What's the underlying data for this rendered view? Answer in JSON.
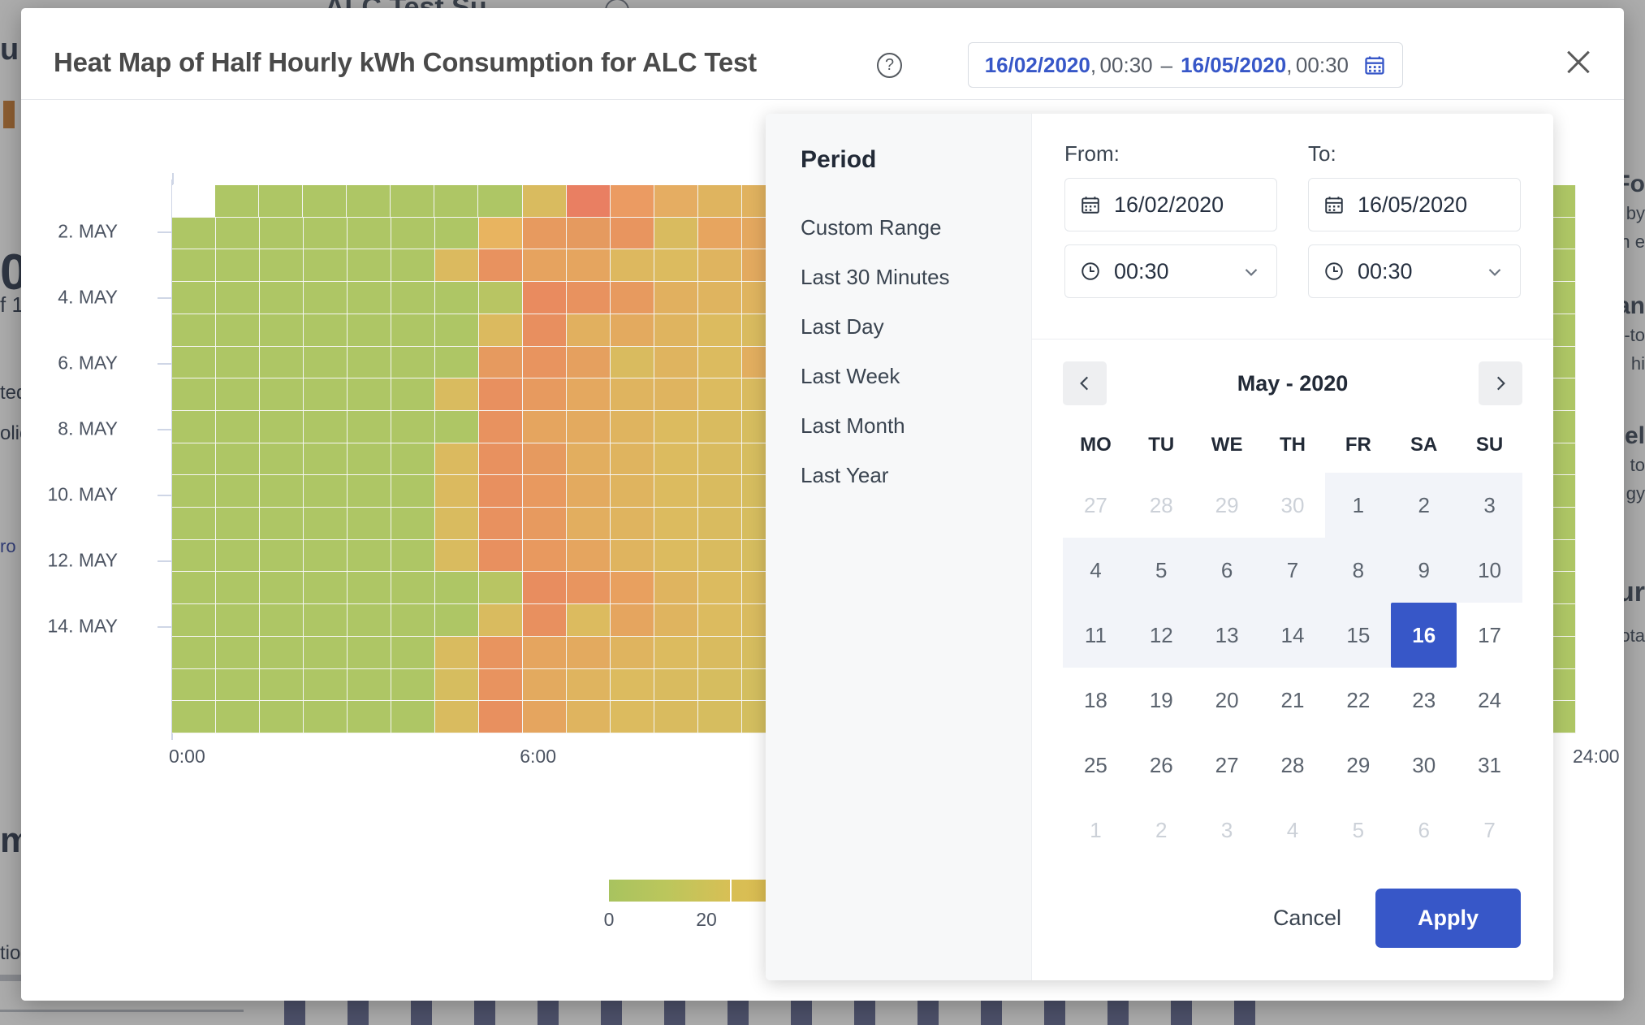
{
  "background": {
    "top_heading": "ALC Test Su",
    "left_fragments": [
      "u:",
      "0",
      "f 1",
      "ted",
      "olic",
      "ro",
      "m",
      "tio"
    ],
    "right_fragments": [
      "Fo",
      "by",
      "n e",
      "an",
      "-to",
      "hi",
      "el",
      "to",
      "gy",
      "ur",
      "ota"
    ]
  },
  "modal": {
    "title": "Heat Map of Half Hourly kWh Consumption for ALC Test",
    "help_icon": "question-mark-circle-icon",
    "close_icon": "close-icon",
    "range_button": {
      "from_date": "16/02/2020",
      "from_time": "00:30",
      "separator": "–",
      "to_date": "16/05/2020",
      "to_time": "00:30",
      "comma": ",",
      "icon": "calendar-icon",
      "accent_color": "#3757c8"
    }
  },
  "chart_data": {
    "type": "heatmap",
    "title": "Heat Map of Half Hourly kWh Consumption for ALC Test",
    "xlabel": "",
    "ylabel": "",
    "x_ticks": [
      "0:00",
      "6:00",
      "24:00"
    ],
    "x_tick_positions": [
      0,
      25,
      100
    ],
    "y_ticks": [
      "2. MAY",
      "4. MAY",
      "6. MAY",
      "8. MAY",
      "10. MAY",
      "12. MAY",
      "14. MAY"
    ],
    "y_tick_positions": [
      8.5,
      20.5,
      32.5,
      44.5,
      56.5,
      68.5,
      80.5
    ],
    "colorbar": {
      "ticks": [
        0,
        20
      ],
      "tick_positions": [
        0,
        50
      ],
      "low_color": "#a8c35f",
      "high_color": "#dcb84e"
    },
    "cell_colors": [
      [
        "#ffffff",
        "#aec665",
        "#aec665",
        "#aec665",
        "#aec665",
        "#aec665",
        "#aec665",
        "#aec665",
        "#d9bb5f",
        "#e97f62",
        "#eb9b62",
        "#e5ad62",
        "#dfb45f",
        "#e0b25f",
        "#e3a95f",
        "#e2a85f",
        "#dfb45f",
        "#dfb45f",
        "#dfb45f",
        "#dcbb5f",
        "#d9bb5f",
        "#d6bd5f",
        "#d0bf5f",
        "#c9c263",
        "#c0c463",
        "#bac563",
        "#b4c563",
        "#aec665",
        "#aec665",
        "#aec665",
        "#aec665",
        "#aec665"
      ],
      [
        "#aec665",
        "#aec665",
        "#aec665",
        "#aec665",
        "#aec665",
        "#aec665",
        "#aec665",
        "#e8b460",
        "#e79a5f",
        "#e59a5f",
        "#e8955f",
        "#d9bb5f",
        "#e7a55f",
        "#e4a85f",
        "#dfb45f",
        "#dfb45f",
        "#dcbb5f",
        "#dcbb5f",
        "#d9bb5f",
        "#d6bd5f",
        "#d3be5f",
        "#cdc062",
        "#c6c363",
        "#c0c463",
        "#b9c563",
        "#b4c563",
        "#aec665",
        "#aec665",
        "#aec665",
        "#aec665",
        "#aec665",
        "#aec665"
      ],
      [
        "#aec665",
        "#aec665",
        "#aec665",
        "#aec665",
        "#aec665",
        "#aec665",
        "#dbba5f",
        "#e8925f",
        "#e6a35f",
        "#e5a55f",
        "#ddb85f",
        "#dcbb5f",
        "#dfb45f",
        "#e3aa5f",
        "#dfb45f",
        "#dcbb5f",
        "#d9bb5f",
        "#d9bb5f",
        "#d6bd5f",
        "#d3be5f",
        "#cdc062",
        "#c6c363",
        "#c0c463",
        "#b9c563",
        "#b4c563",
        "#aec665",
        "#aec665",
        "#aec665",
        "#aec665",
        "#aec665",
        "#aec665",
        "#aec665"
      ],
      [
        "#aec665",
        "#aec665",
        "#aec665",
        "#aec665",
        "#aec665",
        "#aec665",
        "#aec665",
        "#b8c563",
        "#e98b5f",
        "#e8925f",
        "#e79a5f",
        "#e1b05f",
        "#dfb45f",
        "#dfb45f",
        "#dcbb5f",
        "#d9bb5f",
        "#d6bd5f",
        "#d3be5f",
        "#d0bf5f",
        "#cdc062",
        "#c6c363",
        "#c0c463",
        "#b9c563",
        "#b4c563",
        "#aec665",
        "#aec665",
        "#aec665",
        "#aec665",
        "#aec665",
        "#aec665",
        "#aec665",
        "#aec665"
      ],
      [
        "#aec665",
        "#aec665",
        "#aec665",
        "#aec665",
        "#aec665",
        "#aec665",
        "#aec665",
        "#dbba5f",
        "#e88f5f",
        "#e1b05f",
        "#e3aa5f",
        "#dfb45f",
        "#dcbb5f",
        "#d9bb5f",
        "#e0b25f",
        "#d6bd5f",
        "#d3be5f",
        "#d0bf5f",
        "#cdc062",
        "#c6c363",
        "#c0c463",
        "#b9c563",
        "#b4c563",
        "#aec665",
        "#aec665",
        "#aec665",
        "#aec665",
        "#aec665",
        "#aec665",
        "#aec665",
        "#aec665",
        "#aec665"
      ],
      [
        "#aec665",
        "#aec665",
        "#aec665",
        "#aec665",
        "#aec665",
        "#aec665",
        "#aec665",
        "#e69a5f",
        "#e8945f",
        "#e5a05f",
        "#d9bb5f",
        "#dfb45f",
        "#dcbb5f",
        "#e2ae5f",
        "#d6bd5f",
        "#d3be5f",
        "#d0bf5f",
        "#cdc062",
        "#c6c363",
        "#c0c463",
        "#b9c563",
        "#b4c563",
        "#aec665",
        "#aec665",
        "#aec665",
        "#aec665",
        "#aec665",
        "#aec665",
        "#aec665",
        "#aec665",
        "#aec665",
        "#aec665"
      ],
      [
        "#aec665",
        "#aec665",
        "#aec665",
        "#aec665",
        "#aec665",
        "#aec665",
        "#d9bb5f",
        "#e8905f",
        "#e79a5f",
        "#e4a85f",
        "#dfb45f",
        "#dfb45f",
        "#dcbb5f",
        "#d9bb5f",
        "#d6bd5f",
        "#d3be5f",
        "#cdc062",
        "#c6c363",
        "#c0c463",
        "#b9c563",
        "#b4c563",
        "#aec665",
        "#aec665",
        "#aec665",
        "#aec665",
        "#aec665",
        "#aec665",
        "#aec665",
        "#aec665",
        "#aec665",
        "#aec665",
        "#aec665"
      ],
      [
        "#aec665",
        "#aec665",
        "#aec665",
        "#aec665",
        "#aec665",
        "#aec665",
        "#aec665",
        "#e8925f",
        "#e5a55f",
        "#e3aa5f",
        "#dfb45f",
        "#dcbb5f",
        "#d9bb5f",
        "#d6bd5f",
        "#d3be5f",
        "#d0bf5f",
        "#cdc062",
        "#c6c363",
        "#c0c463",
        "#b9c563",
        "#b4c563",
        "#aec665",
        "#aec665",
        "#aec665",
        "#aec665",
        "#aec665",
        "#aec665",
        "#aec665",
        "#aec665",
        "#aec665",
        "#aec665",
        "#aec665"
      ],
      [
        "#aec665",
        "#aec665",
        "#aec665",
        "#aec665",
        "#aec665",
        "#aec665",
        "#dbba5f",
        "#e8915f",
        "#e69a5f",
        "#e2ae5f",
        "#dfb45f",
        "#dcbb5f",
        "#d9bb5f",
        "#d6bd5f",
        "#d3be5f",
        "#d0bf5f",
        "#cdc062",
        "#c6c363",
        "#c0c463",
        "#b9c563",
        "#b4c563",
        "#aec665",
        "#aec665",
        "#aec665",
        "#aec665",
        "#aec665",
        "#aec665",
        "#aec665",
        "#aec665",
        "#aec665",
        "#aec665",
        "#aec665"
      ],
      [
        "#aec665",
        "#aec665",
        "#aec665",
        "#aec665",
        "#aec665",
        "#aec665",
        "#dbba5f",
        "#e8905f",
        "#e8995f",
        "#e3aa5f",
        "#dfb45f",
        "#dcbb5f",
        "#d9bb5f",
        "#d6bd5f",
        "#d3be5f",
        "#d0bf5f",
        "#cdc062",
        "#c6c363",
        "#c0c463",
        "#b9c563",
        "#b4c563",
        "#aec665",
        "#aec665",
        "#aec665",
        "#aec665",
        "#aec665",
        "#aec665",
        "#aec665",
        "#aec665",
        "#aec665",
        "#aec665",
        "#aec665"
      ],
      [
        "#aec665",
        "#aec665",
        "#aec665",
        "#aec665",
        "#aec665",
        "#aec665",
        "#d9bb5f",
        "#e8915f",
        "#e79a5f",
        "#e2ae5f",
        "#dfb45f",
        "#dcbb5f",
        "#d9bb5f",
        "#d6bd5f",
        "#d3be5f",
        "#cdc062",
        "#c6c363",
        "#c0c463",
        "#b9c563",
        "#b4c563",
        "#aec665",
        "#aec665",
        "#aec665",
        "#aec665",
        "#aec665",
        "#aec665",
        "#aec665",
        "#aec665",
        "#aec665",
        "#aec665",
        "#aec665",
        "#aec665"
      ],
      [
        "#aec665",
        "#aec665",
        "#aec665",
        "#aec665",
        "#aec665",
        "#aec665",
        "#d9bb5f",
        "#e8905f",
        "#e8995f",
        "#e5a55f",
        "#dfb45f",
        "#dcbb5f",
        "#d9bb5f",
        "#d6bd5f",
        "#d3be5f",
        "#cdc062",
        "#c6c363",
        "#c0c463",
        "#b9c563",
        "#b4c563",
        "#aec665",
        "#aec665",
        "#aec665",
        "#aec665",
        "#aec665",
        "#aec665",
        "#aec665",
        "#aec665",
        "#aec665",
        "#aec665",
        "#aec665",
        "#aec665"
      ],
      [
        "#aec665",
        "#aec665",
        "#aec665",
        "#aec665",
        "#aec665",
        "#aec665",
        "#aec665",
        "#b8c563",
        "#e88d5f",
        "#e8955f",
        "#e8a05f",
        "#dfb45f",
        "#dcbb5f",
        "#d9bb5f",
        "#d6bd5f",
        "#d3be5f",
        "#cdc062",
        "#c6c363",
        "#c0c463",
        "#b9c563",
        "#b4c563",
        "#aec665",
        "#aec665",
        "#aec665",
        "#aec665",
        "#aec665",
        "#aec665",
        "#aec665",
        "#aec665",
        "#aec665",
        "#aec665",
        "#aec665"
      ],
      [
        "#aec665",
        "#aec665",
        "#aec665",
        "#aec665",
        "#aec665",
        "#aec665",
        "#aec665",
        "#d9bb5f",
        "#e8905f",
        "#dcbb5f",
        "#e5a55f",
        "#dfb45f",
        "#dcbb5f",
        "#d9bb5f",
        "#d6bd5f",
        "#d3be5f",
        "#cdc062",
        "#c6c363",
        "#c0c463",
        "#b9c563",
        "#b4c563",
        "#aec665",
        "#aec665",
        "#aec665",
        "#aec665",
        "#aec665",
        "#aec665",
        "#aec665",
        "#aec665",
        "#aec665",
        "#aec665",
        "#aec665"
      ],
      [
        "#aec665",
        "#aec665",
        "#aec665",
        "#aec665",
        "#aec665",
        "#aec665",
        "#d9bb5f",
        "#e8945f",
        "#e5a55f",
        "#e3aa5f",
        "#dfb45f",
        "#dcbb5f",
        "#d9bb5f",
        "#d6bd5f",
        "#d3be5f",
        "#cdc062",
        "#c6c363",
        "#c0c463",
        "#b9c563",
        "#b4c563",
        "#aec665",
        "#aec665",
        "#aec665",
        "#aec665",
        "#aec665",
        "#aec665",
        "#aec665",
        "#aec665",
        "#aec665",
        "#aec665",
        "#aec665",
        "#aec665"
      ],
      [
        "#aec665",
        "#aec665",
        "#aec665",
        "#aec665",
        "#aec665",
        "#aec665",
        "#d6bd5f",
        "#e8935f",
        "#e3aa5f",
        "#dfb45f",
        "#dcbb5f",
        "#d9bb5f",
        "#d6bd5f",
        "#d3be5f",
        "#d0bf5f",
        "#cdc062",
        "#c6c363",
        "#c0c463",
        "#b9c563",
        "#b4c563",
        "#aec665",
        "#aec665",
        "#aec665",
        "#aec665",
        "#aec665",
        "#aec665",
        "#aec665",
        "#aec665",
        "#aec665",
        "#aec665",
        "#aec665",
        "#aec665"
      ],
      [
        "#aec665",
        "#aec665",
        "#aec665",
        "#aec665",
        "#aec665",
        "#aec665",
        "#d9bb5f",
        "#e8905f",
        "#e5a55f",
        "#dfb45f",
        "#dcbb5f",
        "#d9bb5f",
        "#d6bd5f",
        "#d3be5f",
        "#d0bf5f",
        "#cdc062",
        "#c6c363",
        "#c0c463",
        "#b9c563",
        "#b4c563",
        "#aec665",
        "#aec665",
        "#aec665",
        "#aec665",
        "#aec665",
        "#aec665",
        "#aec665",
        "#aec665",
        "#aec665",
        "#aec665",
        "#aec665",
        "#aec665"
      ]
    ]
  },
  "picker": {
    "side_heading": "Period",
    "periods": [
      "Custom Range",
      "Last 30 Minutes",
      "Last Day",
      "Last Week",
      "Last Month",
      "Last Year"
    ],
    "from": {
      "label": "From:",
      "date": "16/02/2020",
      "time": "00:30",
      "date_icon": "calendar-icon",
      "time_icon": "clock-icon",
      "chevron": "chevron-down-icon"
    },
    "to": {
      "label": "To:",
      "date": "16/05/2020",
      "time": "00:30",
      "date_icon": "calendar-icon",
      "time_icon": "clock-icon",
      "chevron": "chevron-down-icon"
    },
    "calendar": {
      "month_label": "May - 2020",
      "prev_icon": "chevron-left-icon",
      "next_icon": "chevron-right-icon",
      "dow": [
        "MO",
        "TU",
        "WE",
        "TH",
        "FR",
        "SA",
        "SU"
      ],
      "weeks": [
        [
          {
            "d": "27",
            "muted": true,
            "inrange": false,
            "selected": false
          },
          {
            "d": "28",
            "muted": true,
            "inrange": false,
            "selected": false
          },
          {
            "d": "29",
            "muted": true,
            "inrange": false,
            "selected": false
          },
          {
            "d": "30",
            "muted": true,
            "inrange": false,
            "selected": false
          },
          {
            "d": "1",
            "muted": false,
            "inrange": true,
            "selected": false
          },
          {
            "d": "2",
            "muted": false,
            "inrange": true,
            "selected": false
          },
          {
            "d": "3",
            "muted": false,
            "inrange": true,
            "selected": false
          }
        ],
        [
          {
            "d": "4",
            "muted": false,
            "inrange": true,
            "selected": false
          },
          {
            "d": "5",
            "muted": false,
            "inrange": true,
            "selected": false
          },
          {
            "d": "6",
            "muted": false,
            "inrange": true,
            "selected": false
          },
          {
            "d": "7",
            "muted": false,
            "inrange": true,
            "selected": false
          },
          {
            "d": "8",
            "muted": false,
            "inrange": true,
            "selected": false
          },
          {
            "d": "9",
            "muted": false,
            "inrange": true,
            "selected": false
          },
          {
            "d": "10",
            "muted": false,
            "inrange": true,
            "selected": false
          }
        ],
        [
          {
            "d": "11",
            "muted": false,
            "inrange": true,
            "selected": false
          },
          {
            "d": "12",
            "muted": false,
            "inrange": true,
            "selected": false
          },
          {
            "d": "13",
            "muted": false,
            "inrange": true,
            "selected": false
          },
          {
            "d": "14",
            "muted": false,
            "inrange": true,
            "selected": false
          },
          {
            "d": "15",
            "muted": false,
            "inrange": true,
            "selected": false
          },
          {
            "d": "16",
            "muted": false,
            "inrange": true,
            "selected": true
          },
          {
            "d": "17",
            "muted": false,
            "inrange": false,
            "selected": false
          }
        ],
        [
          {
            "d": "18",
            "muted": false,
            "inrange": false,
            "selected": false
          },
          {
            "d": "19",
            "muted": false,
            "inrange": false,
            "selected": false
          },
          {
            "d": "20",
            "muted": false,
            "inrange": false,
            "selected": false
          },
          {
            "d": "21",
            "muted": false,
            "inrange": false,
            "selected": false
          },
          {
            "d": "22",
            "muted": false,
            "inrange": false,
            "selected": false
          },
          {
            "d": "23",
            "muted": false,
            "inrange": false,
            "selected": false
          },
          {
            "d": "24",
            "muted": false,
            "inrange": false,
            "selected": false
          }
        ],
        [
          {
            "d": "25",
            "muted": false,
            "inrange": false,
            "selected": false
          },
          {
            "d": "26",
            "muted": false,
            "inrange": false,
            "selected": false
          },
          {
            "d": "27",
            "muted": false,
            "inrange": false,
            "selected": false
          },
          {
            "d": "28",
            "muted": false,
            "inrange": false,
            "selected": false
          },
          {
            "d": "29",
            "muted": false,
            "inrange": false,
            "selected": false
          },
          {
            "d": "30",
            "muted": false,
            "inrange": false,
            "selected": false
          },
          {
            "d": "31",
            "muted": false,
            "inrange": false,
            "selected": false
          }
        ],
        [
          {
            "d": "1",
            "muted": true,
            "inrange": false,
            "selected": false
          },
          {
            "d": "2",
            "muted": true,
            "inrange": false,
            "selected": false
          },
          {
            "d": "3",
            "muted": true,
            "inrange": false,
            "selected": false
          },
          {
            "d": "4",
            "muted": true,
            "inrange": false,
            "selected": false
          },
          {
            "d": "5",
            "muted": true,
            "inrange": false,
            "selected": false
          },
          {
            "d": "6",
            "muted": true,
            "inrange": false,
            "selected": false
          },
          {
            "d": "7",
            "muted": true,
            "inrange": false,
            "selected": false
          }
        ]
      ]
    },
    "cancel_label": "Cancel",
    "apply_label": "Apply",
    "accent_color": "#3757c8"
  }
}
